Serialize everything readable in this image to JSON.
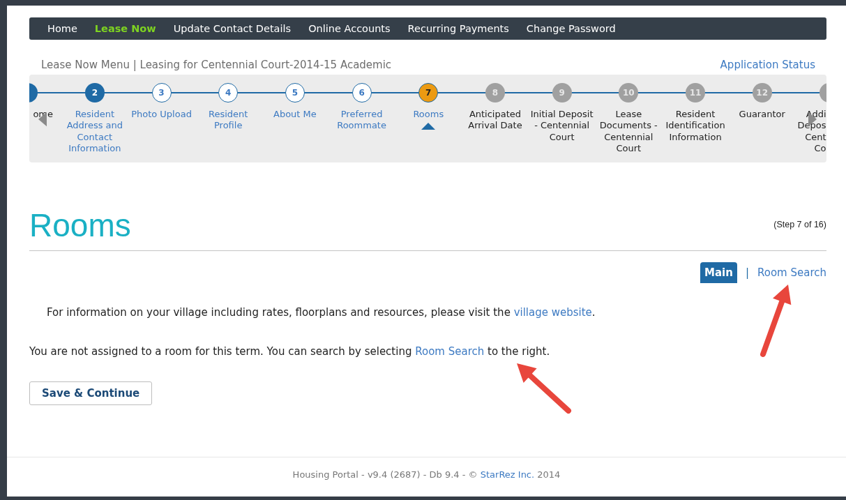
{
  "nav": {
    "items": [
      {
        "label": "Home",
        "selected": false
      },
      {
        "label": "Lease Now",
        "selected": true
      },
      {
        "label": "Update Contact Details",
        "selected": false
      },
      {
        "label": "Online Accounts",
        "selected": false
      },
      {
        "label": "Recurring Payments",
        "selected": false
      },
      {
        "label": "Change Password",
        "selected": false
      }
    ]
  },
  "breadcrumb": "Lease Now Menu | Leasing for Centennial Court-2014-15 Academic",
  "status_link": "Application Status",
  "steps": [
    {
      "label": "ome",
      "kind": "complete"
    },
    {
      "number": "2",
      "label": "Resident Address and Contact Information",
      "kind": "complete"
    },
    {
      "number": "3",
      "label": "Photo Upload",
      "kind": "visited"
    },
    {
      "number": "4",
      "label": "Resident Profile",
      "kind": "visited"
    },
    {
      "number": "5",
      "label": "About Me",
      "kind": "visited"
    },
    {
      "number": "6",
      "label": "Preferred Roommate",
      "kind": "visited"
    },
    {
      "number": "7",
      "label": "Rooms",
      "kind": "current"
    },
    {
      "number": "8",
      "label": "Anticipated Arrival Date",
      "kind": "locked"
    },
    {
      "number": "9",
      "label": "Initial Deposit - Centennial Court",
      "kind": "locked"
    },
    {
      "number": "10",
      "label": "Lease Documents - Centennial Court",
      "kind": "locked"
    },
    {
      "number": "11",
      "label": "Resident Identification Information",
      "kind": "locked"
    },
    {
      "number": "12",
      "label": "Guarantor",
      "kind": "locked"
    },
    {
      "label": "Addi\nDepos\nCent\nCo",
      "kind": "locked"
    }
  ],
  "page": {
    "title": "Rooms",
    "step_indicator": "(Step 7 of 16)"
  },
  "tabs": [
    {
      "label": "Main",
      "selected": true
    },
    {
      "label": "Room Search",
      "selected": false
    }
  ],
  "tab_separator": "|",
  "info": {
    "before": "For information on your village including rates, floorplans and resources, please visit the ",
    "link": "village website",
    "after": "."
  },
  "notice": {
    "before": "You are not assigned to a room for this term. You can search by selecting ",
    "link": "Room Search",
    "after": " to the right."
  },
  "button": "Save & Continue",
  "footer": {
    "before": "Housing Portal - v9.4 (2687) - Db 9.4 - © ",
    "link": "StarRez Inc.",
    "after": " 2014"
  }
}
